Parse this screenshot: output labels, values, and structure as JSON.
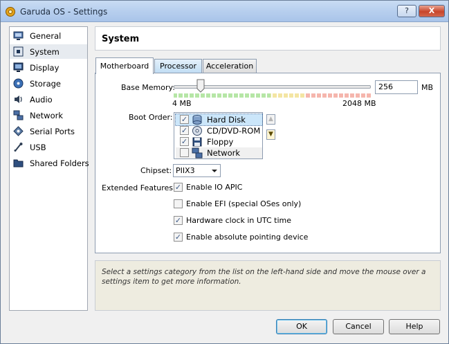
{
  "window": {
    "title": "Garuda OS - Settings",
    "help_label": "?",
    "close_label": "X"
  },
  "sidebar": {
    "items": [
      {
        "label": "General",
        "icon": "general-icon"
      },
      {
        "label": "System",
        "icon": "system-icon",
        "selected": true
      },
      {
        "label": "Display",
        "icon": "display-icon"
      },
      {
        "label": "Storage",
        "icon": "storage-icon"
      },
      {
        "label": "Audio",
        "icon": "audio-icon"
      },
      {
        "label": "Network",
        "icon": "network-icon"
      },
      {
        "label": "Serial Ports",
        "icon": "serial-ports-icon"
      },
      {
        "label": "USB",
        "icon": "usb-icon"
      },
      {
        "label": "Shared Folders",
        "icon": "shared-folders-icon"
      }
    ]
  },
  "header": {
    "title": "System"
  },
  "tabs": [
    {
      "label": "Motherboard",
      "active": true
    },
    {
      "label": "Processor",
      "hover": true
    },
    {
      "label": "Acceleration"
    }
  ],
  "motherboard": {
    "base_memory_label": "Base Memory:",
    "memory_value": "256",
    "memory_unit": "MB",
    "slider_min": "4 MB",
    "slider_max": "2048 MB",
    "boot_order_label": "Boot Order:",
    "boot_items": [
      {
        "label": "Hard Disk",
        "checked": true,
        "icon": "hard-disk-icon"
      },
      {
        "label": "CD/DVD-ROM",
        "checked": true,
        "icon": "cd-dvd-icon"
      },
      {
        "label": "Floppy",
        "checked": true,
        "icon": "floppy-icon"
      },
      {
        "label": "Network",
        "checked": false,
        "icon": "network-boot-icon"
      }
    ],
    "chipset_label": "Chipset:",
    "chipset_value": "PIIX3",
    "extended_features_label": "Extended Features:",
    "features": [
      {
        "label": "Enable IO APIC",
        "checked": true
      },
      {
        "label": "Enable EFI (special OSes only)",
        "checked": false
      },
      {
        "label": "Hardware clock in UTC time",
        "checked": true
      },
      {
        "label": "Enable absolute pointing device",
        "checked": true
      }
    ]
  },
  "info": {
    "text": "Select a settings category from the list on the left-hand side and move the mouse over a settings item to get more information."
  },
  "buttons": {
    "ok": "OK",
    "cancel": "Cancel",
    "help": "Help"
  },
  "colors": {
    "selection": "#cbe6fa",
    "info_bg": "#eeece0",
    "check": "#3d5a87"
  }
}
